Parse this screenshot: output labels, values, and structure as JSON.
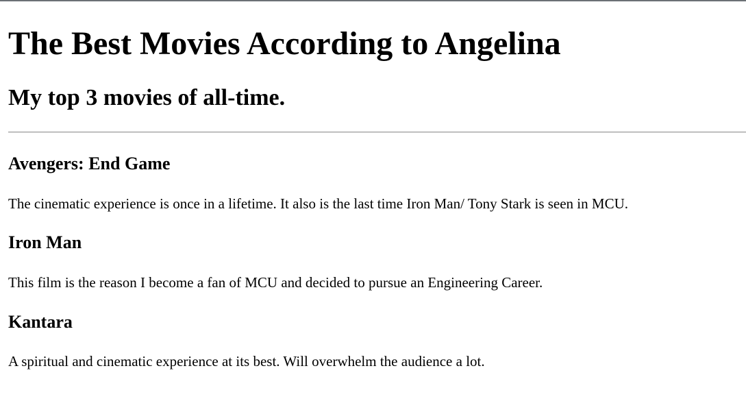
{
  "header": {
    "title": "The Best Movies According to Angelina",
    "subtitle": "My top 3 movies of all-time."
  },
  "movies": [
    {
      "title": "Avengers: End Game",
      "description": "The cinematic experience is once in a lifetime. It also is the last time Iron Man/ Tony Stark is seen in MCU."
    },
    {
      "title": "Iron Man",
      "description": "This film is the reason I become a fan of MCU and decided to pursue an Engineering Career."
    },
    {
      "title": "Kantara",
      "description": "A spiritual and cinematic experience at its best. Will overwhelm the audience a lot."
    }
  ]
}
